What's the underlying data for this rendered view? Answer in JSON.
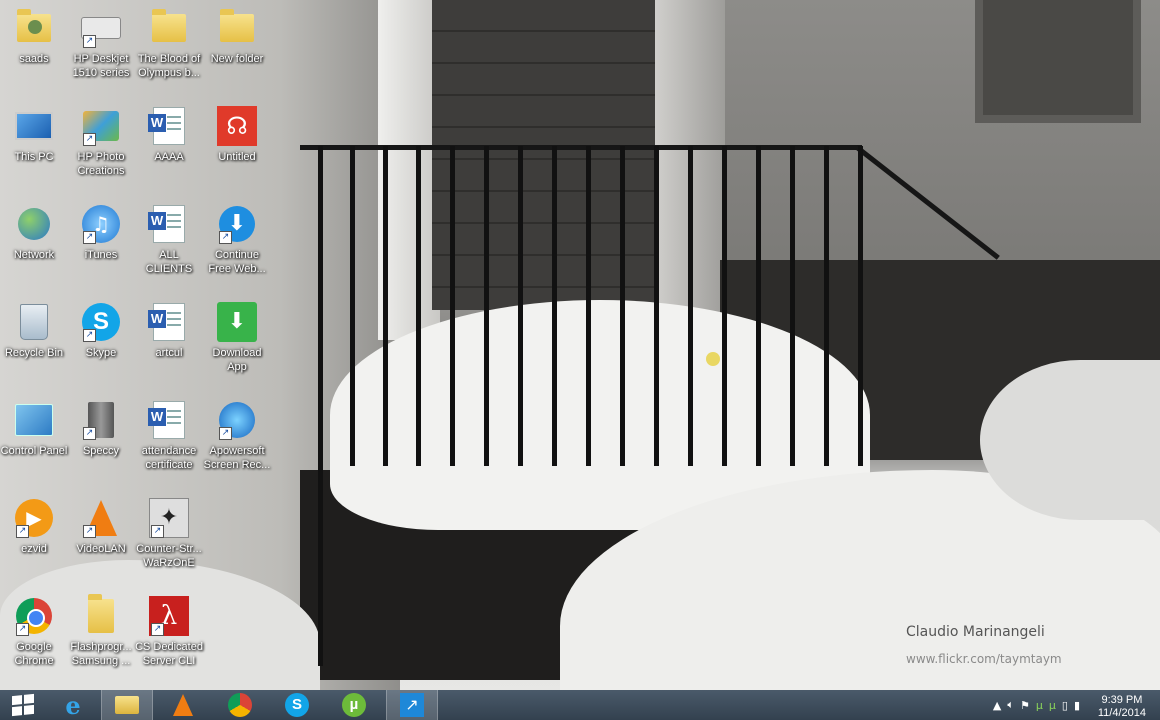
{
  "desktop": {
    "icons": [
      {
        "label": "saads",
        "icon": "user-folder-icon"
      },
      {
        "label": "HP Deskjet 1510 series",
        "icon": "printer-icon"
      },
      {
        "label": "The Blood of Olympus b...",
        "icon": "folder-icon"
      },
      {
        "label": "New folder",
        "icon": "folder-icon"
      },
      {
        "label": "This PC",
        "icon": "computer-icon"
      },
      {
        "label": "HP Photo Creations",
        "icon": "photo-app-icon"
      },
      {
        "label": "AAAA",
        "icon": "word-document-icon"
      },
      {
        "label": "Untitled",
        "icon": "headphones-icon"
      },
      {
        "label": "Network",
        "icon": "network-globe-icon"
      },
      {
        "label": "iTunes",
        "icon": "itunes-icon"
      },
      {
        "label": "ALL CLIENTS",
        "icon": "word-document-icon"
      },
      {
        "label": "Continue Free Web...",
        "icon": "download-arrow-icon"
      },
      {
        "label": "Recycle Bin",
        "icon": "recycle-bin-icon"
      },
      {
        "label": "Skype",
        "icon": "skype-icon"
      },
      {
        "label": "artcul",
        "icon": "word-document-icon"
      },
      {
        "label": "Download App",
        "icon": "download-app-icon"
      },
      {
        "label": "Control Panel",
        "icon": "control-panel-icon"
      },
      {
        "label": "Speccy",
        "icon": "speccy-icon"
      },
      {
        "label": "attendance certificate",
        "icon": "word-document-icon"
      },
      {
        "label": "Apowersoft Screen Rec...",
        "icon": "screen-recorder-icon"
      },
      {
        "label": "ezvid",
        "icon": "ezvid-play-icon"
      },
      {
        "label": "VideoLAN",
        "icon": "vlc-cone-icon"
      },
      {
        "label": "Counter-Str... WaRzOnE",
        "icon": "counter-strike-icon"
      },
      {
        "label": "Google Chrome",
        "icon": "chrome-icon"
      },
      {
        "label": "Flashprogr... Samsung ...",
        "icon": "folder-icon"
      },
      {
        "label": "CS Dedicated Server CLI",
        "icon": "half-life-icon"
      }
    ]
  },
  "wallpaper": {
    "credit_name": "Claudio Marinangeli",
    "credit_url": "www.flickr.com/taymtaym"
  },
  "taskbar": {
    "start": "start-windows-icon",
    "pinned": [
      {
        "icon": "internet-explorer-icon",
        "active": false
      },
      {
        "icon": "file-explorer-icon",
        "active": true
      },
      {
        "icon": "vlc-cone-icon",
        "active": false
      },
      {
        "icon": "chrome-icon",
        "active": false
      },
      {
        "icon": "skype-icon",
        "active": false
      },
      {
        "icon": "utorrent-icon",
        "active": false
      },
      {
        "icon": "remote-arrow-icon",
        "active": false
      }
    ],
    "clock": {
      "time": "9:39 PM",
      "date": "11/4/2014"
    }
  },
  "colors": {
    "taskbar": "#3b4a59",
    "accent_red": "#e03a2a",
    "accent_blue": "#1e78d2"
  }
}
